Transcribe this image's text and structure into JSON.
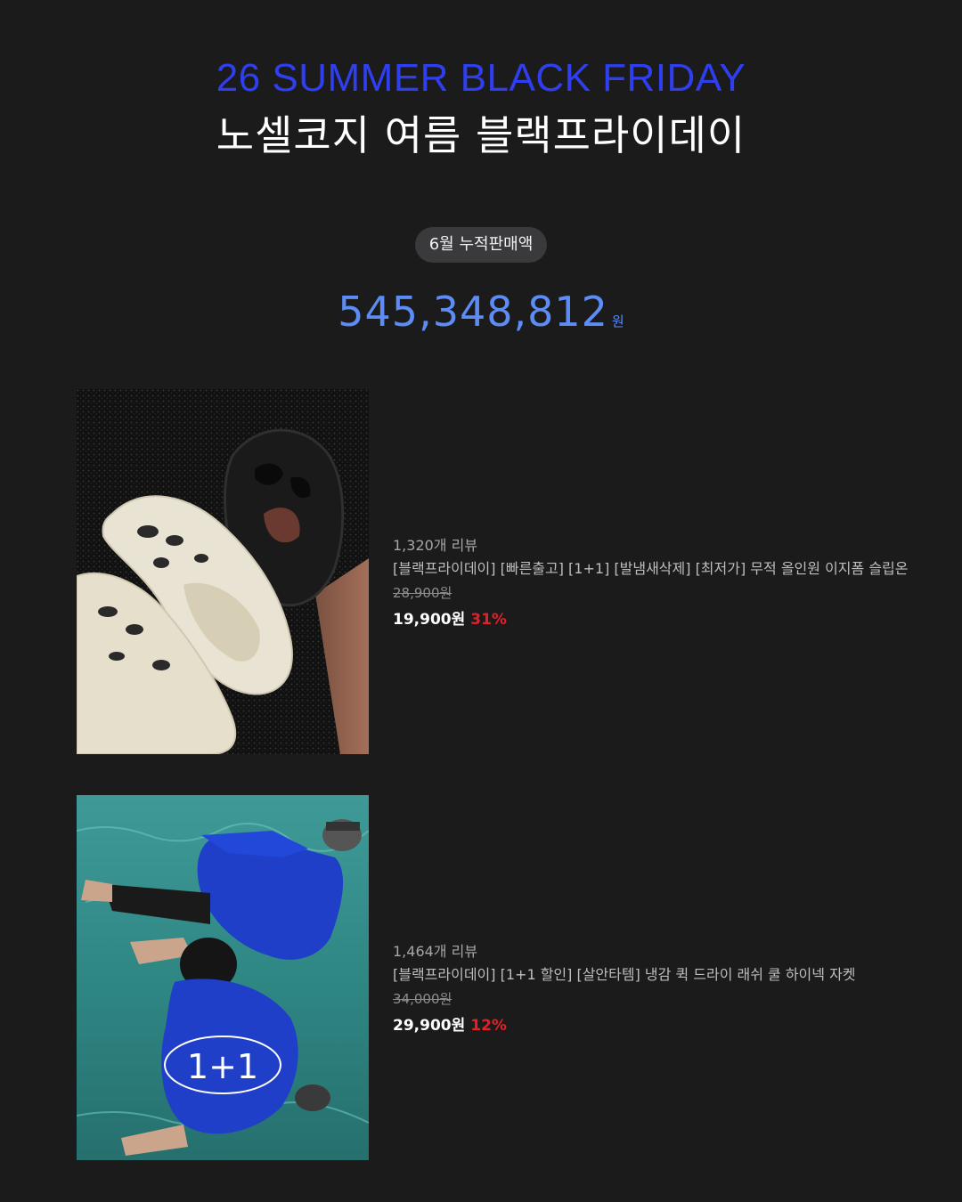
{
  "header": {
    "title_en": "26 SUMMER BLACK FRIDAY",
    "title_ko": "노셀코지 여름 블랙프라이데이"
  },
  "sales": {
    "label": "6월 누적판매액",
    "amount": "545,348,812",
    "unit": "원"
  },
  "products": [
    {
      "image_icon": "sandal-photo",
      "reviews": "1,320개 리뷰",
      "name": "[블랙프라이데이] [빠른출고] [1+1] [발냄새삭제] [최저가] 무적 올인원 이지폼 슬립온",
      "original_price": "28,900원",
      "sale_price": "19,900원",
      "discount": "31%"
    },
    {
      "image_icon": "jacket-pool-photo",
      "badge": "1+1",
      "reviews": "1,464개 리뷰",
      "name": "[블랙프라이데이] [1+1 할인] [살안타템] 냉감 퀵 드라이 래쉬 쿨 하이넥 자켓",
      "original_price": "34,000원",
      "sale_price": "29,900원",
      "discount": "12%"
    }
  ],
  "colors": {
    "background": "#1b1b1c",
    "title_blue": "#2f3ff0",
    "amount_blue": "#5d8cf5",
    "discount_red": "#e3202a",
    "pill": "#3a3a3c"
  }
}
